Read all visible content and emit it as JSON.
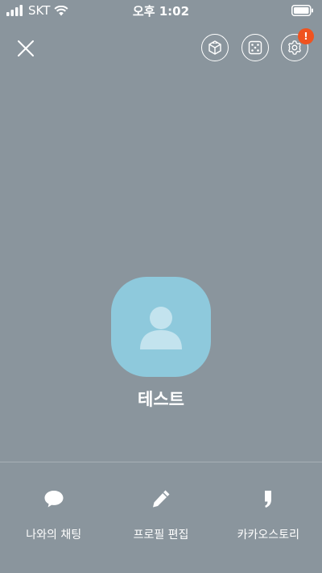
{
  "status_bar": {
    "carrier": "SKT",
    "time": "오후 1:02"
  },
  "top_bar": {
    "alert_badge": "!"
  },
  "profile": {
    "name": "테스트"
  },
  "actions": [
    {
      "label": "나와의 채팅",
      "icon": "chat-bubble-icon"
    },
    {
      "label": "프로필 편집",
      "icon": "pencil-icon"
    },
    {
      "label": "카카오스토리",
      "icon": "kakaostory-icon"
    }
  ],
  "colors": {
    "background": "#8a959d",
    "avatar": "#8ec9dc",
    "badge": "#f0531f"
  }
}
